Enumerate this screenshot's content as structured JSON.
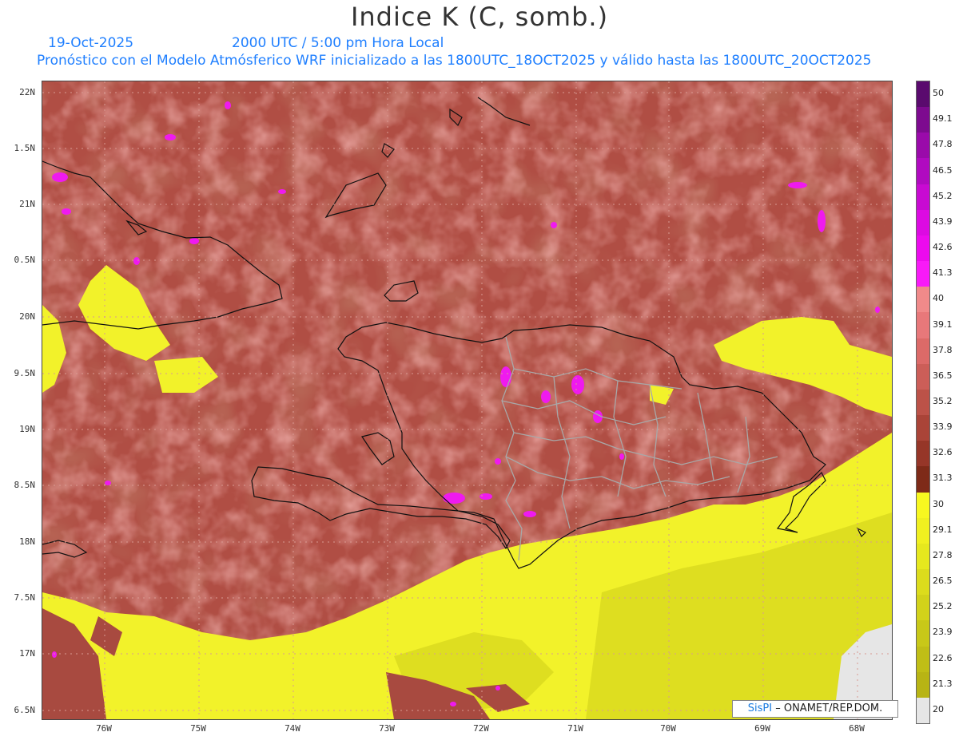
{
  "header": {
    "title": "Indice K (C, somb.)",
    "date": "19-Oct-2025",
    "time": "2000 UTC / 5:00 pm Hora Local",
    "description": "Pronóstico con el Modelo Atmósferico WRF inicializado a las 1800UTC_18OCT2025 y válido hasta las  1800UTC_20OCT2025"
  },
  "map": {
    "lat_labels": [
      "22N",
      "1.5N",
      "21N",
      "0.5N",
      "20N",
      "9.5N",
      "19N",
      "8.5N",
      "18N",
      "7.5N",
      "17N",
      "6.5N"
    ],
    "lon_labels": [
      "76W",
      "75W",
      "74W",
      "73W",
      "72W",
      "71W",
      "70W",
      "69W",
      "68W"
    ]
  },
  "colorbar": {
    "labels": [
      "50",
      "49.1",
      "47.8",
      "46.5",
      "45.2",
      "43.9",
      "42.6",
      "41.3",
      "40",
      "39.1",
      "37.8",
      "36.5",
      "35.2",
      "33.9",
      "32.6",
      "31.3",
      "30",
      "29.1",
      "27.8",
      "26.5",
      "25.2",
      "23.9",
      "22.6",
      "21.3",
      "20"
    ],
    "colors": [
      "#5a0a6e",
      "#7d0a8f",
      "#9a0aaa",
      "#b00ac0",
      "#c80ad2",
      "#dc0ae2",
      "#ec0aee",
      "#f81af8",
      "#f08a8a",
      "#e8787a",
      "#dc6a68",
      "#cc5e58",
      "#bc5248",
      "#aa4438",
      "#963628",
      "#7e2a18",
      "#f8f820",
      "#f0f020",
      "#e6e81e",
      "#dcdc1c",
      "#d2d21a",
      "#c8c818",
      "#c0be16",
      "#b8b414",
      "#e6e6e6"
    ]
  },
  "credit": {
    "brand": "SisPI",
    "text": " – ONAMET/REP.DOM."
  }
}
